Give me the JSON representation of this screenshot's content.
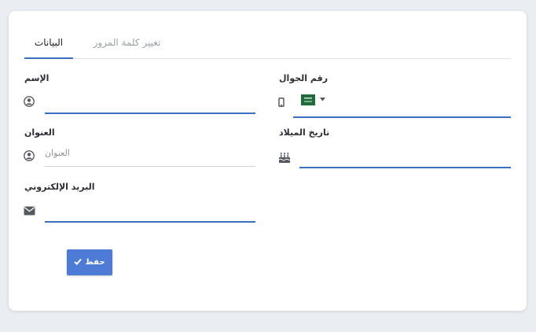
{
  "tabs": {
    "active": "البيانات",
    "other": "تغيير كلمة المرور"
  },
  "fields": {
    "name": {
      "label": "الإسم",
      "value": ""
    },
    "address": {
      "label": "العنوان",
      "placeholder": "العنوان"
    },
    "email": {
      "label": "البريد الإلكتروني",
      "value": ""
    },
    "mobile": {
      "label": "رقم الجوال",
      "value": "",
      "country": "SA"
    },
    "birthdate": {
      "label": "تاريخ الميلاد",
      "value": ""
    }
  },
  "buttons": {
    "save": "حفظ"
  },
  "icons": {
    "name": "user-circle-icon",
    "address": "user-circle-icon",
    "email": "envelope-icon",
    "mobile": "mobile-phone-icon",
    "birthdate": "birthday-cake-icon",
    "flag": "saudi-flag-icon",
    "dropdown": "caret-down-icon",
    "save": "check-icon"
  },
  "colors": {
    "accent": "#3b6fc2",
    "button": "#4d7bd6",
    "background": "#eaeef2",
    "flag": "#1f6b3a"
  }
}
